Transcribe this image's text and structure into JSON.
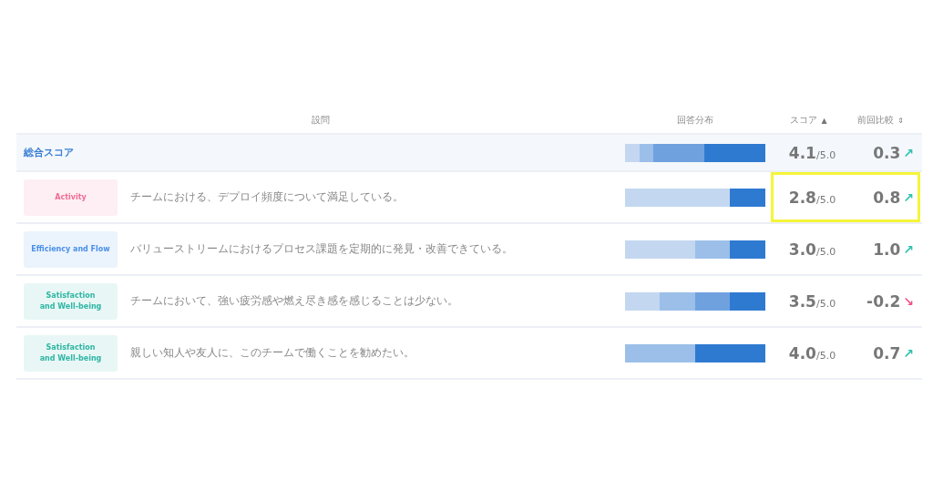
{
  "columns": [
    {
      "label": "設問"
    },
    {
      "label": "回答分布"
    },
    {
      "label": "スコア",
      "sort_icon": "▲"
    },
    {
      "label": "前回比較",
      "sort_icon": "⇕"
    }
  ],
  "total": {
    "label": "総合スコア",
    "score": "4.1",
    "max": "/5.0",
    "delta": "0.3",
    "trend_icon": "↗",
    "rising": true,
    "highlighted": false
  },
  "rows": [
    {
      "category": [
        "Activity"
      ],
      "color": "#f06b96",
      "question": "チームにおける、デプロイ頻度について満足している。",
      "score": "2.8",
      "max": "/5.0",
      "delta": "0.8",
      "trend_icon": "↗",
      "rising": true,
      "highlighted": true
    },
    {
      "category": [
        "Efficiency and Flow"
      ],
      "color": "#4a90e8",
      "question": "バリューストリームにおけるプロセス課題を定期的に発見・改善できている。",
      "score": "3.0",
      "max": "/5.0",
      "delta": "1.0",
      "trend_icon": "↗",
      "rising": true,
      "highlighted": false
    },
    {
      "category": [
        "Satisfaction",
        "and Well-being"
      ],
      "color": "#2fb5a4",
      "question": "チームにおいて、強い疲労感や燃え尽き感を感じることは少ない。",
      "score": "3.5",
      "max": "/5.0",
      "delta": "-0.2",
      "trend_icon": "↘",
      "rising": false,
      "highlighted": false
    },
    {
      "category": [
        "Satisfaction",
        "and Well-being"
      ],
      "color": "#2fb5a4",
      "question": "親しい知人や友人に、このチームで働くことを勧めたい。",
      "score": "4.0",
      "max": "/5.0",
      "delta": "0.7",
      "trend_icon": "↗",
      "rising": true,
      "highlighted": false
    }
  ]
}
